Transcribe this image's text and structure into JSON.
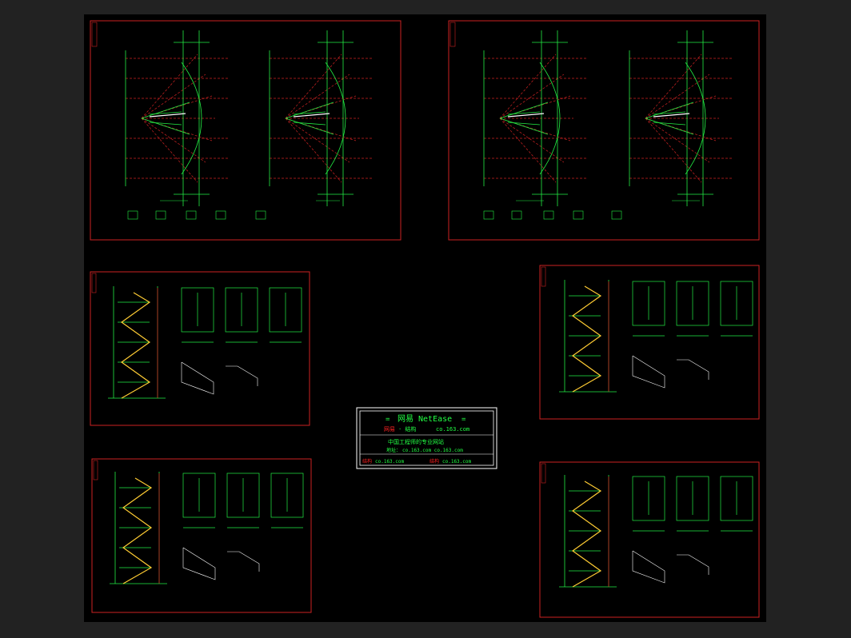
{
  "stamp": {
    "title": "网易 NetEase",
    "left_mark": "=",
    "right_mark": "=",
    "brand_red": "网易",
    "brand_green": "· 结构",
    "site": "co.163.com",
    "slogan": "中国工程师的专业网站",
    "url_label": "地址：",
    "url": "co.163.com   co.163.com",
    "footer_left_red": "结构",
    "footer_left": "co.163.com",
    "footer_right_red": "结构",
    "footer_right": "co.163.com"
  },
  "colors": {
    "background": "#000000",
    "frame": "#cc2222",
    "line": "#22ee44",
    "accent": "#ff3333",
    "hatch": "#ffff44",
    "stamp_border": "#ffffff"
  }
}
